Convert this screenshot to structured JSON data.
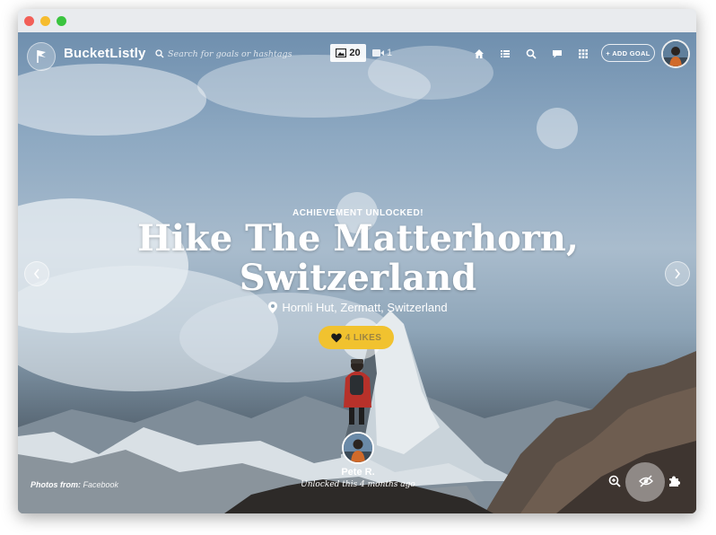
{
  "header": {
    "brand": "BucketListly",
    "search_placeholder": "Search for goals or hashtags",
    "photo_count": "20",
    "video_count": "1",
    "add_goal_label": "+ ADD GOAL"
  },
  "hero": {
    "badge": "ACHIEVEMENT UNLOCKED!",
    "title_line1": "Hike The Matterhorn,",
    "title_line2": "Switzerland",
    "location": "Hornli Hut, Zermatt, Switzerland",
    "likes_label": "4 LIKES"
  },
  "footer": {
    "user_name": "Pete R.",
    "unlock_time": "Unlocked this 4 months ago",
    "photos_from_label": "Photos from:",
    "photos_from_source": "Facebook"
  },
  "colors": {
    "likes_button": "#f1c22f",
    "window_red": "#f25f58",
    "window_yellow": "#f6bc2f",
    "window_green": "#3bc43f"
  },
  "icons": [
    "flag-logo-icon",
    "search-icon",
    "photo-icon",
    "video-icon",
    "home-icon",
    "list-icon",
    "search-nav-icon",
    "chat-icon",
    "grid-icon",
    "location-pin-icon",
    "heart-icon",
    "chevron-left-icon",
    "chevron-right-icon",
    "zoom-in-icon",
    "eye-slash-icon",
    "puzzle-icon"
  ]
}
